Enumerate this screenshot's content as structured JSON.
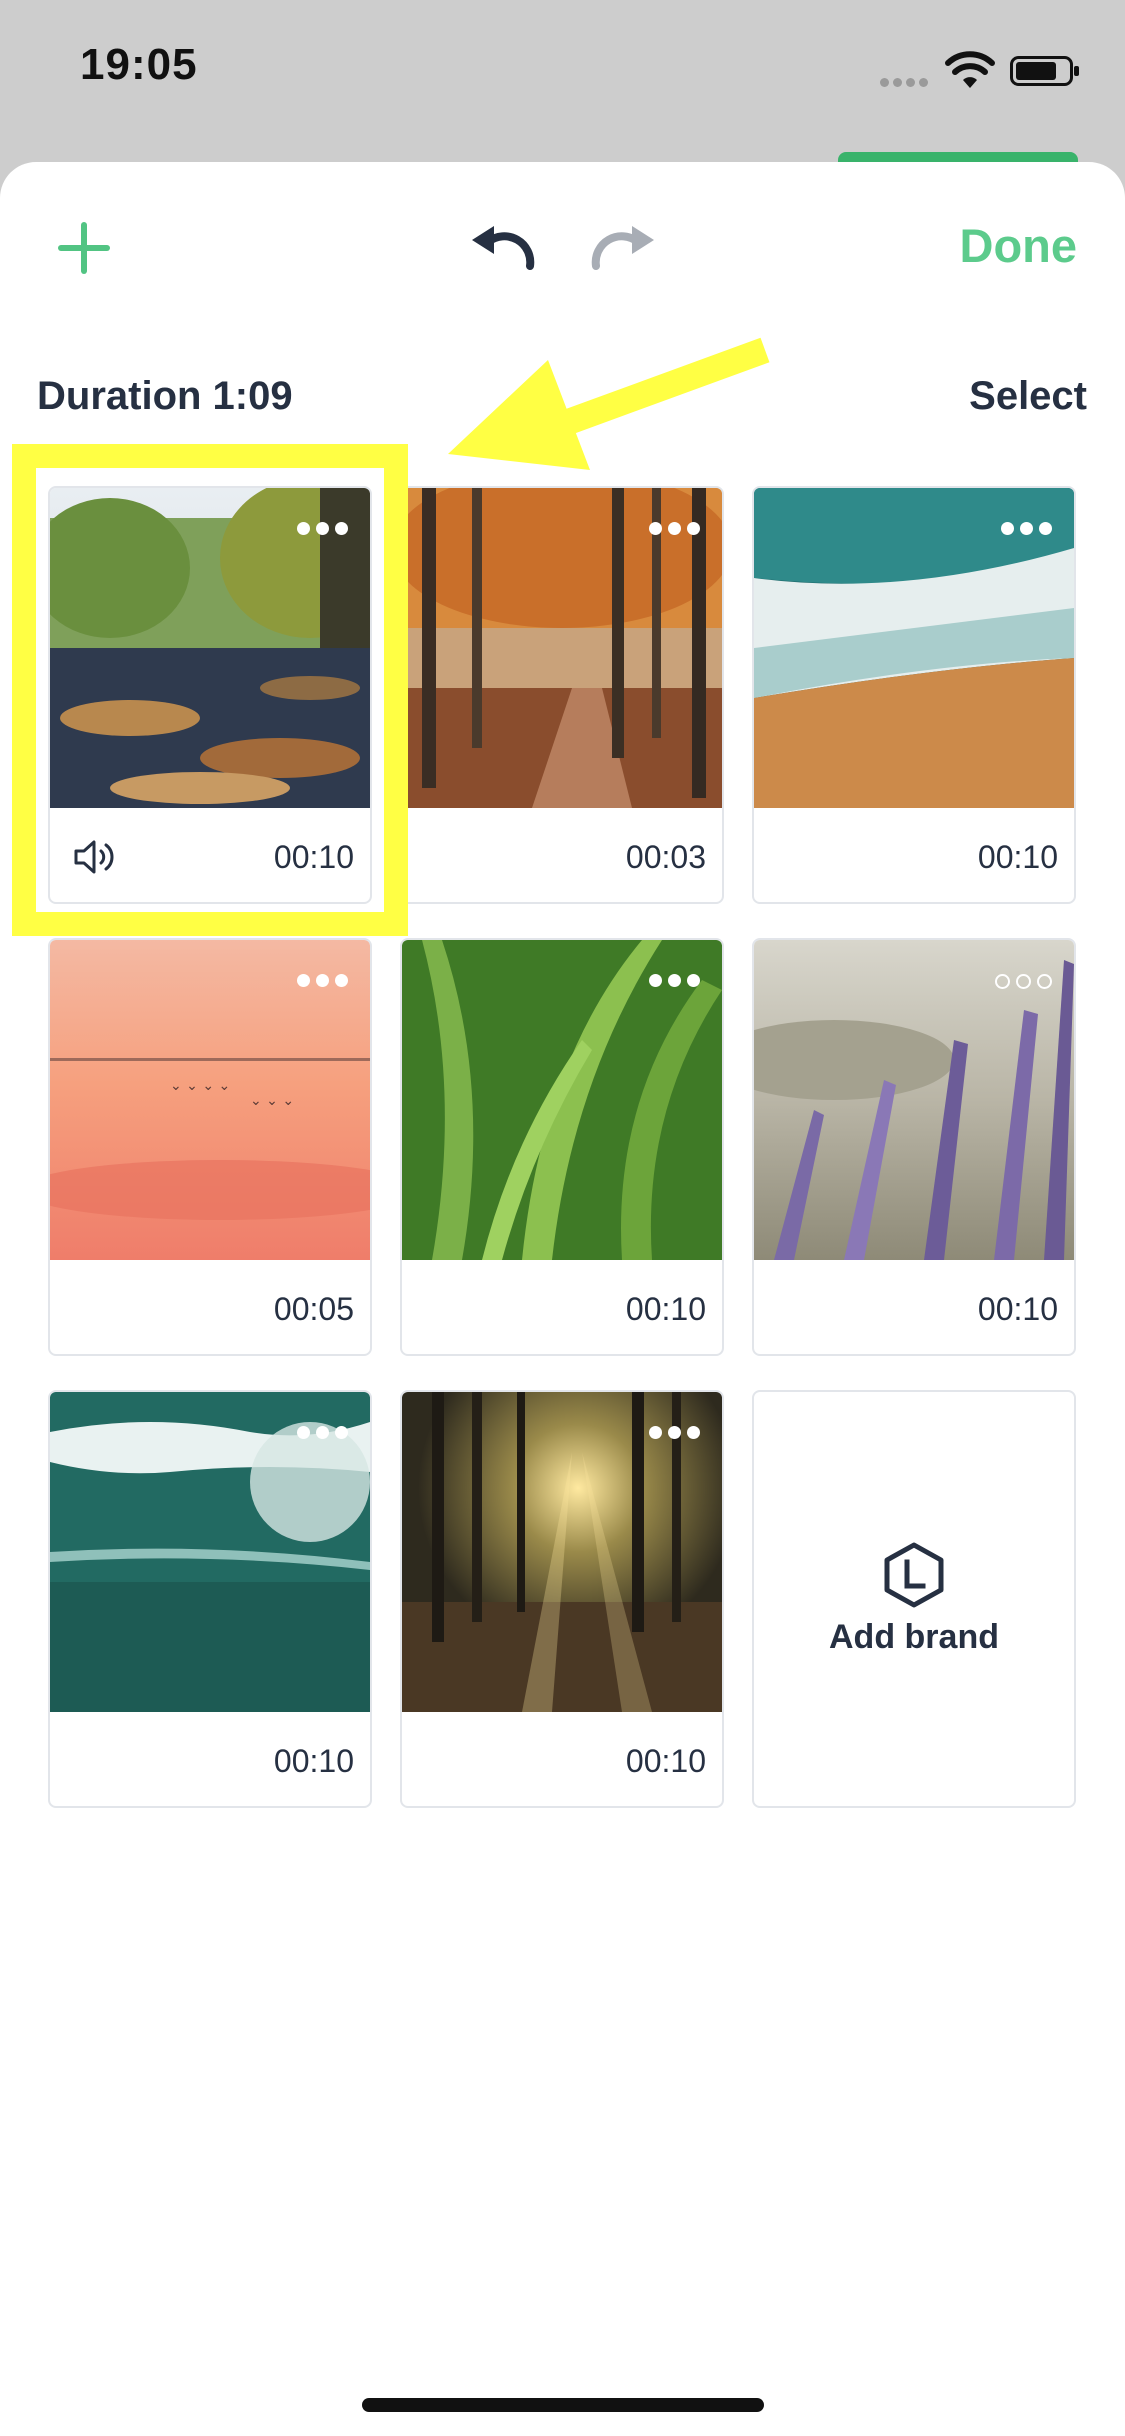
{
  "status_bar": {
    "time": "19:05"
  },
  "toolbar": {
    "done_label": "Done"
  },
  "header": {
    "duration_label": "Duration 1:09",
    "select_label": "Select"
  },
  "clips": [
    {
      "duration": "00:10",
      "scene": "leaves-road",
      "has_sound_icon": true
    },
    {
      "duration": "00:03",
      "scene": "autumn-forest"
    },
    {
      "duration": "00:10",
      "scene": "ocean-beach"
    },
    {
      "duration": "00:05",
      "scene": "sunset-birds"
    },
    {
      "duration": "00:10",
      "scene": "grass"
    },
    {
      "duration": "00:10",
      "scene": "lavender"
    },
    {
      "duration": "00:10",
      "scene": "teal-wave"
    },
    {
      "duration": "00:10",
      "scene": "forest-sunlight"
    }
  ],
  "add_brand": {
    "label": "Add brand",
    "icon": "brand-hexagon-icon"
  },
  "colors": {
    "accent": "#5ccb8c",
    "highlight": "#ffff44",
    "text": "#263042"
  }
}
